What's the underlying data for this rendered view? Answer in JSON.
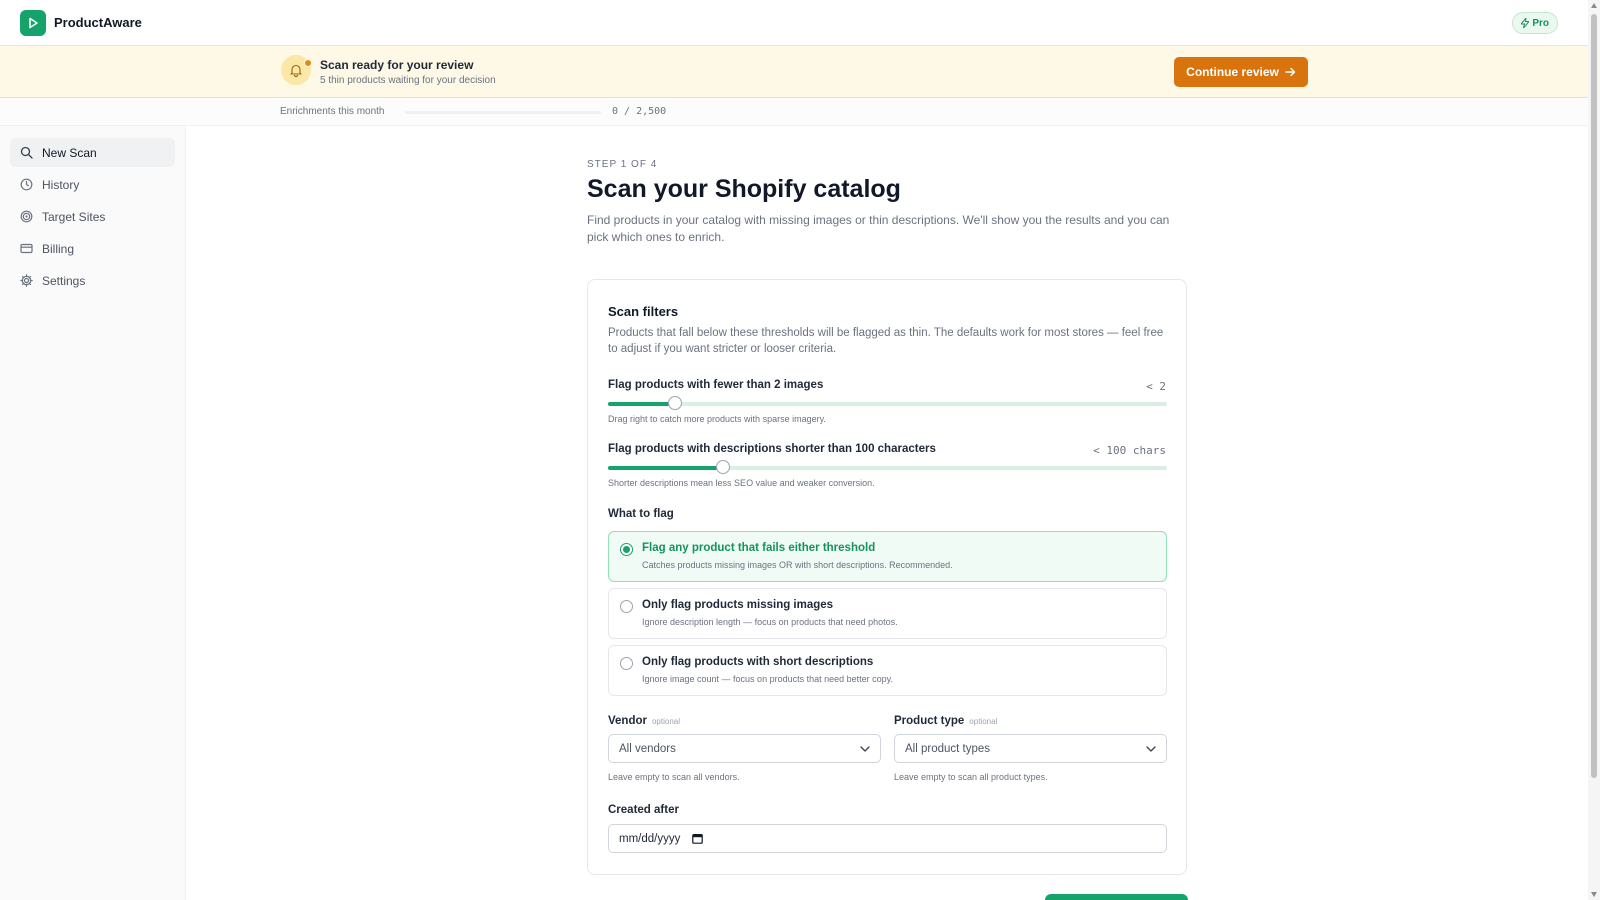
{
  "app": {
    "name": "ProductAware",
    "plan_badge": "Pro",
    "logo_icon": "play-logo-icon"
  },
  "banner": {
    "title": "Scan ready for your review",
    "subtitle": "5 thin products waiting for your decision",
    "button_label": "Continue review"
  },
  "usage": {
    "label": "Enrichments this month",
    "used": 0,
    "limit": 2500,
    "count_text": "0 / 2,500"
  },
  "sidebar": {
    "items": [
      {
        "label": "New Scan",
        "icon": "search-icon",
        "active": true
      },
      {
        "label": "History",
        "icon": "clock-icon",
        "active": false
      },
      {
        "label": "Target Sites",
        "icon": "target-icon",
        "active": false
      },
      {
        "label": "Billing",
        "icon": "credit-card-icon",
        "active": false
      },
      {
        "label": "Settings",
        "icon": "gear-icon",
        "active": false
      }
    ]
  },
  "page": {
    "step": "STEP 1 OF 4",
    "title": "Scan your Shopify catalog",
    "intro": "Find products in your catalog with missing images or thin descriptions. We'll show you the results and you can pick which ones to enrich."
  },
  "filters": {
    "title": "Scan filters",
    "description": "Products that fall below these thresholds will be flagged as thin. The defaults work for most stores — feel free to adjust if you want stricter or looser criteria.",
    "images_slider": {
      "label": "Flag products with fewer than 2 images",
      "value_text": "< 2",
      "fraction": 0.12,
      "hint": "Drag right to catch more products with sparse imagery."
    },
    "desc_slider": {
      "label": "Flag products with descriptions shorter than 100 characters",
      "value_text": "< 100 chars",
      "fraction": 0.205,
      "hint": "Shorter descriptions mean less SEO value and weaker conversion."
    },
    "what_to_flag_label": "What to flag",
    "options": [
      {
        "title": "Flag any product that fails either threshold",
        "desc": "Catches products missing images OR with short descriptions. Recommended.",
        "selected": true
      },
      {
        "title": "Only flag products missing images",
        "desc": "Ignore description length — focus on products that need photos.",
        "selected": false
      },
      {
        "title": "Only flag products with short descriptions",
        "desc": "Ignore image count — focus on products that need better copy.",
        "selected": false
      }
    ],
    "vendor": {
      "label": "Vendor",
      "optional": "optional",
      "value": "All vendors",
      "hint": "Leave empty to scan all vendors."
    },
    "product_type": {
      "label": "Product type",
      "optional": "optional",
      "value": "All product types",
      "hint": "Leave empty to scan all product types."
    },
    "created_after": {
      "label": "Created after",
      "placeholder": "mm/dd/yyyy"
    }
  },
  "colors": {
    "accent": "#16a36b",
    "warning": "#d9730d",
    "banner_bg": "#fef8e6"
  }
}
